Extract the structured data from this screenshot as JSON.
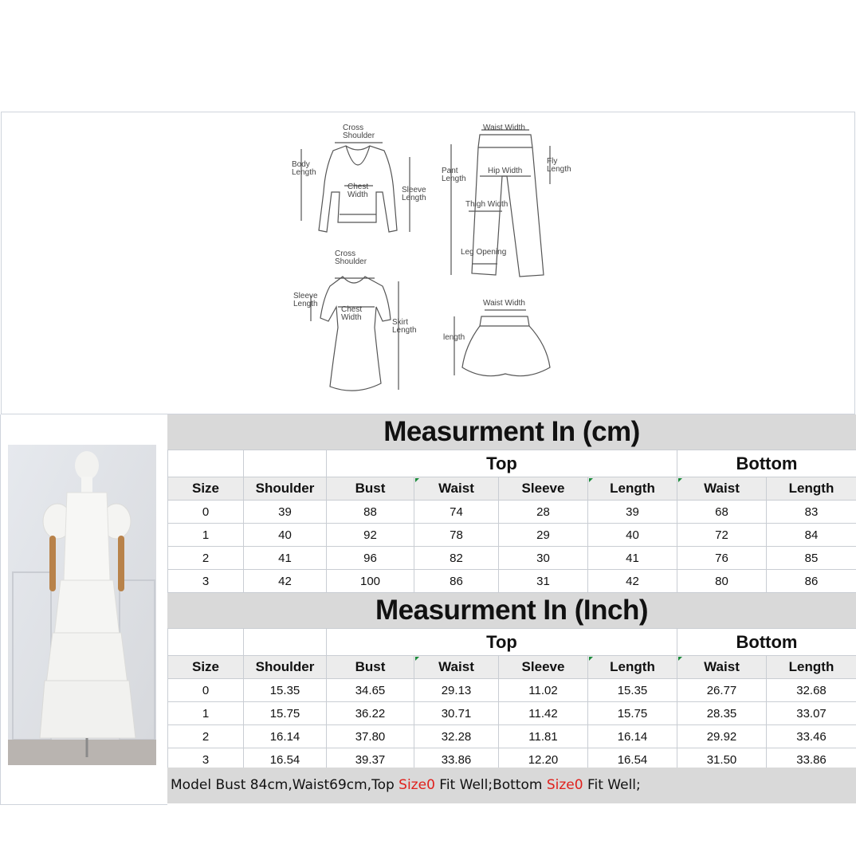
{
  "diagram": {
    "top": {
      "cross_shoulder": [
        "Cross",
        "Shoulder"
      ],
      "body_length": [
        "Body",
        "Length"
      ],
      "chest_width": [
        "Chest",
        "Width"
      ],
      "sleeve_length": [
        "Sleeve",
        "Length"
      ]
    },
    "pants": {
      "waist_width": "Waist Width",
      "pant_length": [
        "Pant",
        "Length"
      ],
      "fly_length": [
        "Fly",
        "Length"
      ],
      "hip_width": "Hip Width",
      "thigh_width": "Thigh Width",
      "leg_opening": "Leg Opening"
    },
    "dress": {
      "cross_shoulder": [
        "Cross",
        "Shoulder"
      ],
      "sleeve_length": [
        "Sleeve",
        "Length"
      ],
      "chest_width": [
        "Chest",
        "Width"
      ],
      "skirt_length": [
        "Skirt",
        "Length"
      ]
    },
    "skirt": {
      "waist_width": "Waist Width",
      "length": "length"
    }
  },
  "cm_table": {
    "title": "Measurment In (cm)",
    "group_top": "Top",
    "group_bottom": "Bottom",
    "headers": [
      "Size",
      "Shoulder",
      "Bust",
      "Waist",
      "Sleeve",
      "Length",
      "Waist",
      "Length"
    ],
    "rows": [
      [
        "0",
        "39",
        "88",
        "74",
        "28",
        "39",
        "68",
        "83"
      ],
      [
        "1",
        "40",
        "92",
        "78",
        "29",
        "40",
        "72",
        "84"
      ],
      [
        "2",
        "41",
        "96",
        "82",
        "30",
        "41",
        "76",
        "85"
      ],
      [
        "3",
        "42",
        "100",
        "86",
        "31",
        "42",
        "80",
        "86"
      ]
    ]
  },
  "inch_table": {
    "title": "Measurment In (Inch)",
    "group_top": "Top",
    "group_bottom": "Bottom",
    "headers": [
      "Size",
      "Shoulder",
      "Bust",
      "Waist",
      "Sleeve",
      "Length",
      "Waist",
      "Length"
    ],
    "rows": [
      [
        "0",
        "15.35",
        "34.65",
        "29.13",
        "11.02",
        "15.35",
        "26.77",
        "32.68"
      ],
      [
        "1",
        "15.75",
        "36.22",
        "30.71",
        "11.42",
        "15.75",
        "28.35",
        "33.07"
      ],
      [
        "2",
        "16.14",
        "37.80",
        "32.28",
        "11.81",
        "16.14",
        "29.92",
        "33.46"
      ],
      [
        "3",
        "16.54",
        "39.37",
        "33.86",
        "12.20",
        "16.54",
        "31.50",
        "33.86"
      ]
    ]
  },
  "footnote": {
    "part1": "Model Bust 84cm,Waist69cm,Top ",
    "size_top": "Size0",
    "part2": " Fit Well;Bottom ",
    "size_bottom": "Size0",
    "part3": " Fit Well;"
  },
  "colors": {
    "banner_bg": "#d9d9d9",
    "highlight": "#e0201c",
    "cell_marker": "#1a8a3a"
  }
}
